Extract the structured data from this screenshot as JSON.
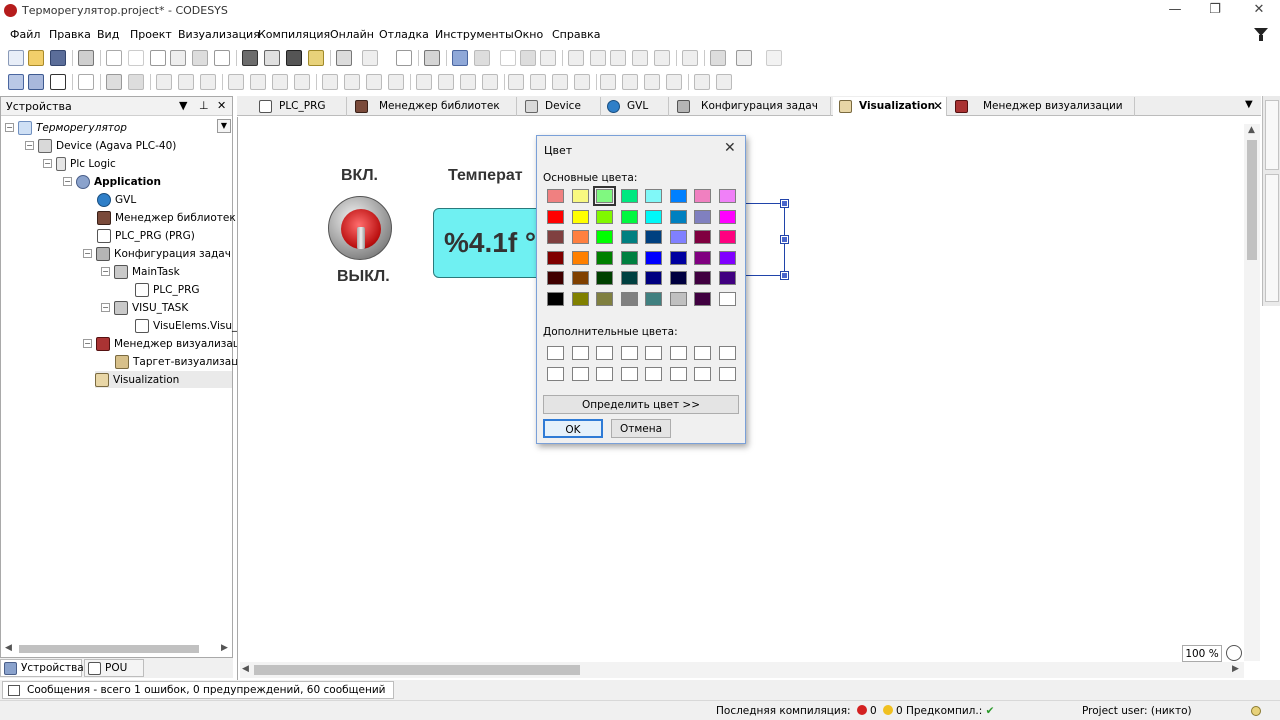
{
  "window": {
    "title": "Терморегулятор.project* - CODESYS",
    "controls": [
      "—",
      "❐",
      "✕"
    ]
  },
  "menu": [
    "Файл",
    "Правка",
    "Вид",
    "Проект",
    "Визуализация",
    "Компиляция",
    "Онлайн",
    "Отладка",
    "Инструменты",
    "Окно",
    "Справка"
  ],
  "devices_panel": {
    "title": "Устройства",
    "tree": [
      {
        "label": "Терморегулятор",
        "icon": "project-icon",
        "italic": true
      },
      {
        "label": "Device (Agava PLC-40)",
        "icon": "device-icon"
      },
      {
        "label": "Plc Logic",
        "icon": "plc-logic-icon"
      },
      {
        "label": "Application",
        "icon": "application-icon",
        "bold": true
      },
      {
        "label": "GVL",
        "icon": "globe-icon"
      },
      {
        "label": "Менеджер библиотек",
        "icon": "library-icon"
      },
      {
        "label": "PLC_PRG (PRG)",
        "icon": "program-icon"
      },
      {
        "label": "Конфигурация задач",
        "icon": "task-config-icon"
      },
      {
        "label": "MainTask",
        "icon": "task-icon"
      },
      {
        "label": "PLC_PRG",
        "icon": "program-call-icon"
      },
      {
        "label": "VISU_TASK",
        "icon": "task-icon"
      },
      {
        "label": "VisuElems.Visu_Pr",
        "icon": "program-call-icon"
      },
      {
        "label": "Менеджер визуализаци",
        "icon": "visu-manager-icon"
      },
      {
        "label": "Таргет-визуализаци",
        "icon": "target-visu-icon"
      },
      {
        "label": "Visualization",
        "icon": "visualization-icon"
      }
    ],
    "bottom_tabs": [
      "Устройства",
      "POU"
    ]
  },
  "editor_tabs": [
    {
      "label": "PLC_PRG"
    },
    {
      "label": "Менеджер библиотек"
    },
    {
      "label": "Device"
    },
    {
      "label": "GVL"
    },
    {
      "label": "Конфигурация задач"
    },
    {
      "label": "Visualization",
      "active": true
    },
    {
      "label": "Менеджер визуализации"
    }
  ],
  "visualization": {
    "on_label": "ВКЛ.",
    "off_label": "ВЫКЛ.",
    "temp_label": "Температ",
    "temp_format": "%4.1f °"
  },
  "color_dialog": {
    "title": "Цвет",
    "basic_label": "Основные цвета:",
    "custom_label": "Дополнительные цвета:",
    "define_button": "Определить цвет >>",
    "ok_button": "OK",
    "cancel_button": "Отмена",
    "basic_colors": [
      [
        "#f08080",
        "#f8f880",
        "#80f880",
        "#00e880",
        "#80f8f8",
        "#0080ff",
        "#f080c0",
        "#f080f8"
      ],
      [
        "#ff0000",
        "#ffff00",
        "#80f800",
        "#00f840",
        "#00f8f8",
        "#0080c0",
        "#8080c0",
        "#ff00ff"
      ],
      [
        "#804040",
        "#ff8040",
        "#00ff00",
        "#008080",
        "#004080",
        "#8080ff",
        "#800040",
        "#ff0080"
      ],
      [
        "#800000",
        "#ff8000",
        "#008000",
        "#008040",
        "#0000ff",
        "#0000a0",
        "#800080",
        "#8000ff"
      ],
      [
        "#400000",
        "#804000",
        "#004000",
        "#004040",
        "#000080",
        "#000040",
        "#400040",
        "#400080"
      ],
      [
        "#000000",
        "#808000",
        "#808040",
        "#808080",
        "#408080",
        "#c0c0c0",
        "#400040",
        "#ffffff"
      ]
    ],
    "selected_color": "#80f880"
  },
  "zoom": "100 %",
  "messages": "Сообщения - всего 1 ошибок, 0 предупреждений, 60 сообщений",
  "status": {
    "last_build": "Последняя компиляция:",
    "errors": "0",
    "warnings": "0",
    "precompile": "Предкомпил.:",
    "project_user": "Project user: (никто)"
  }
}
